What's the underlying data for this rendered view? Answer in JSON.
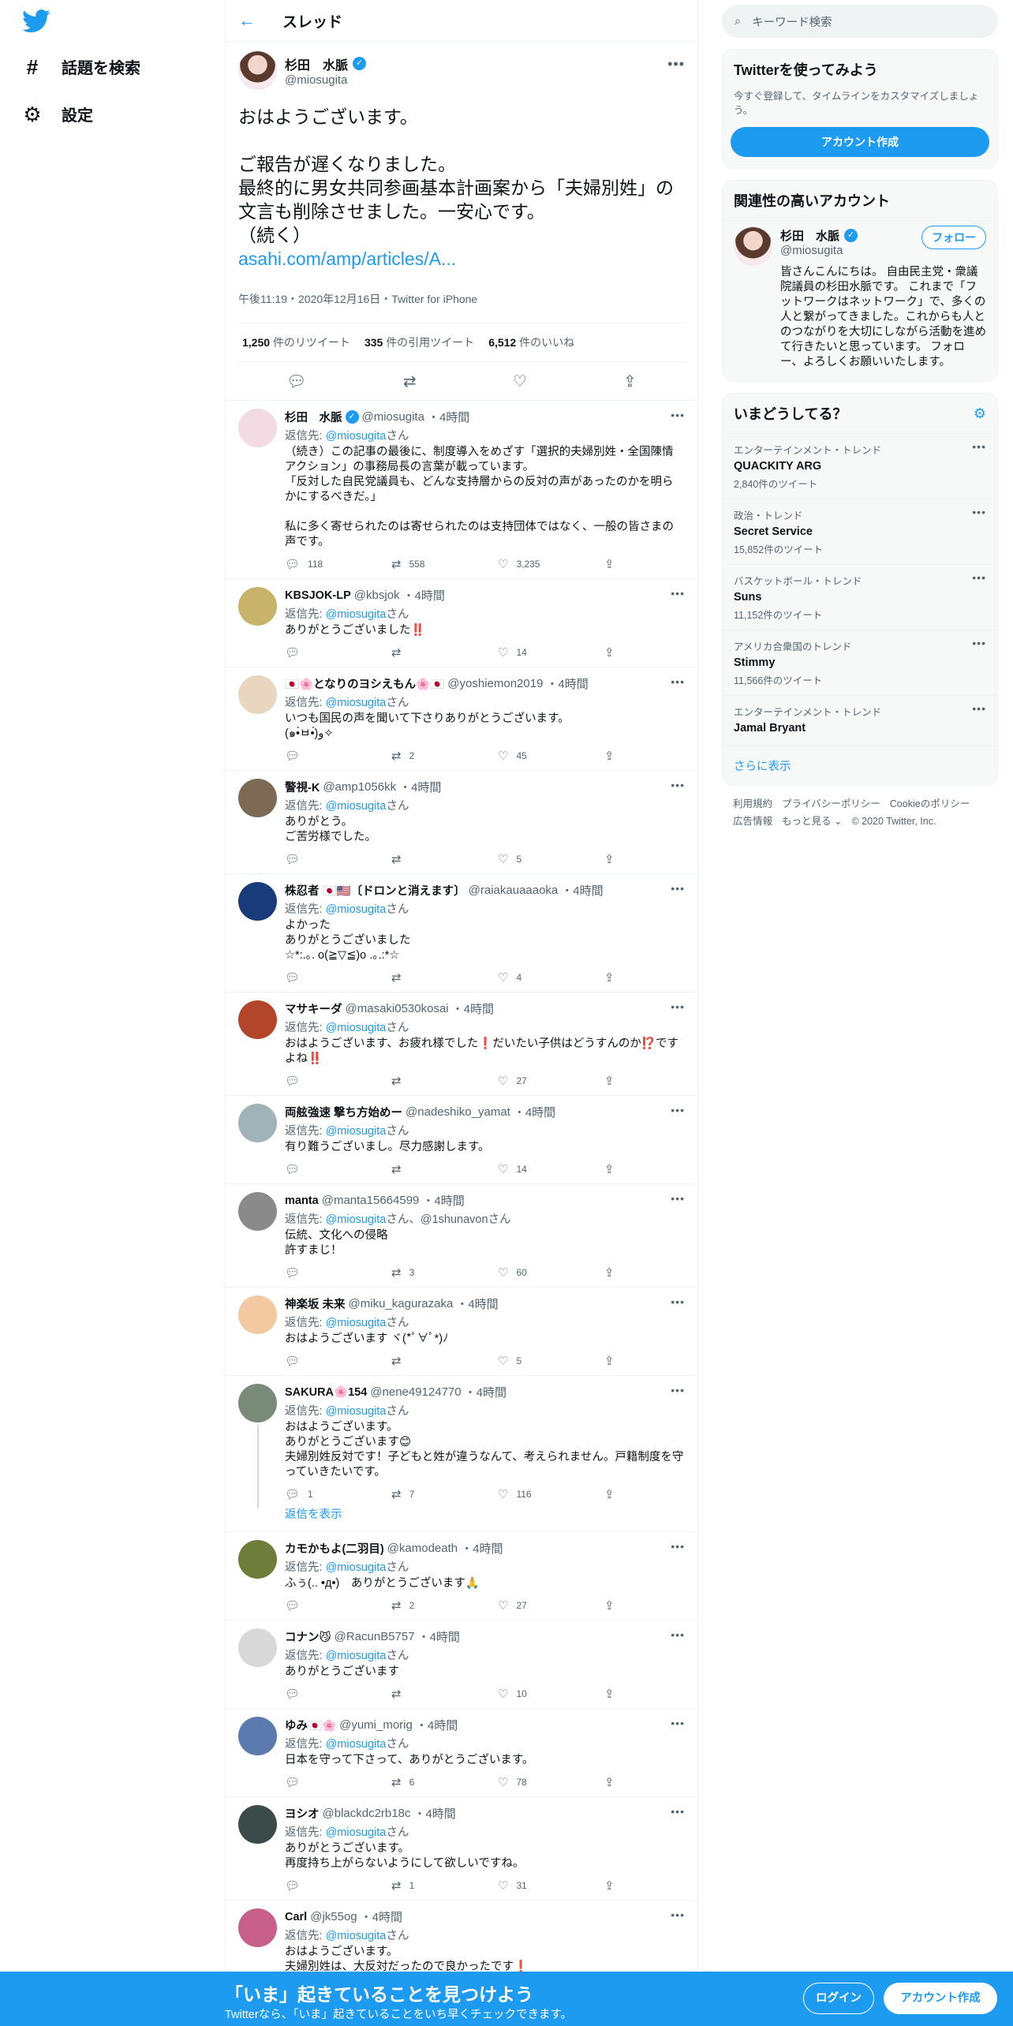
{
  "nav": {
    "explore_label": "話題を検索",
    "settings_label": "設定"
  },
  "header": {
    "title": "スレッド"
  },
  "focal_tweet": {
    "name": "杉田　水脈",
    "handle": "@miosugita",
    "text": "おはようございます。\n\nご報告が遅くなりました。\n最終的に男女共同参画基本計画案から「夫婦別姓」の文言も削除させました。一安心です。\n（続く）",
    "link": "asahi.com/amp/articles/A...",
    "meta": "午後11:19・2020年12月16日・Twitter for iPhone",
    "retweets_count": "1,250",
    "retweets_label": "件のリツイート",
    "quotes_count": "335",
    "quotes_label": "件の引用ツイート",
    "likes_count": "6,512",
    "likes_label": "件のいいね"
  },
  "replies": [
    {
      "name": "杉田　水脈",
      "handle": "@miosugita",
      "time": "・4時間",
      "to_prefix": "返信先: ",
      "to": "@miosugita",
      "to_suffix": "さん",
      "text": "（続き）この記事の最後に、制度導入をめざす「選択的夫婦別姓・全国陳情アクション」の事務局長の言葉が載っています。\n「反対した自民党議員も、どんな支持層からの反対の声があったのかを明らかにするべきだ。」\n\n私に多く寄せられたのは寄せられたのは支持団体ではなく、一般の皆さまの声です。",
      "replies": "118",
      "retweets": "558",
      "likes": "3,235"
    },
    {
      "name": "KBSJOK-LP",
      "handle": "@kbsjok",
      "time": "・4時間",
      "to_prefix": "返信先: ",
      "to": "@miosugita",
      "to_suffix": "さん",
      "text": "ありがとうございました‼️",
      "replies": "",
      "retweets": "",
      "likes": "14"
    },
    {
      "name": "🇯🇵🌸となりのヨシえもん🌸🇯🇵",
      "handle": "@yoshiemon2019",
      "time": "・4時間",
      "to_prefix": "返信先: ",
      "to": "@miosugita",
      "to_suffix": "さん",
      "text": "いつも国民の声を聞いて下さりありがとうございます。\n(๑•̀ㅂ•́)و✧",
      "replies": "",
      "retweets": "2",
      "likes": "45"
    },
    {
      "name": "警視-K",
      "handle": "@amp1056kk",
      "time": "・4時間",
      "to_prefix": "返信先: ",
      "to": "@miosugita",
      "to_suffix": "さん",
      "text": "ありがとう。\nご苦労様でした。",
      "replies": "",
      "retweets": "",
      "likes": "5"
    },
    {
      "name": "株忍者 🇯🇵🇺🇸〔ドロンと消えます〕",
      "handle": "@raiakauaaaoka",
      "time": "・4時間",
      "to_prefix": "返信先: ",
      "to": "@miosugita",
      "to_suffix": "さん",
      "text": "よかった\nありがとうございました\n☆*:.｡. o(≧▽≦)o .｡.:*☆",
      "replies": "",
      "retweets": "",
      "likes": "4"
    },
    {
      "name": "マサキーダ",
      "handle": "@masaki0530kosai",
      "time": "・4時間",
      "to_prefix": "返信先: ",
      "to": "@miosugita",
      "to_suffix": "さん",
      "text": "おはようございます、お疲れ様でした❗️だいたい子供はどうすんのか⁉️ですよね‼️",
      "replies": "",
      "retweets": "",
      "likes": "27"
    },
    {
      "name": "両舷強速 撃ち方始めー",
      "handle": "@nadeshiko_yamat",
      "time": "・4時間",
      "to_prefix": "返信先: ",
      "to": "@miosugita",
      "to_suffix": "さん",
      "text": "有り難うございまし。尽力感謝します。",
      "replies": "",
      "retweets": "",
      "likes": "14"
    },
    {
      "name": "manta",
      "handle": "@manta15664599",
      "time": "・4時間",
      "to_prefix": "返信先: ",
      "to": "@miosugita",
      "to_suffix": "さん、@1shunavonさん",
      "text": "伝統、文化への侵略\n許すまじ！",
      "replies": "",
      "retweets": "3",
      "likes": "60"
    },
    {
      "name": "神楽坂 未来",
      "handle": "@miku_kagurazaka",
      "time": "・4時間",
      "to_prefix": "返信先: ",
      "to": "@miosugita",
      "to_suffix": "さん",
      "text": "おはようございます ヾ(*ﾟ∀ﾟ*)ﾉ",
      "replies": "",
      "retweets": "",
      "likes": "5"
    },
    {
      "name": "SAKURA🌸154",
      "handle": "@nene49124770",
      "time": "・4時間",
      "to_prefix": "返信先: ",
      "to": "@miosugita",
      "to_suffix": "さん",
      "text": "おはようございます。\nありがとうございます😊\n夫婦別姓反対です！子どもと姓が違うなんて、考えられません。戸籍制度を守っていきたいです。",
      "replies": "1",
      "retweets": "7",
      "likes": "116"
    },
    {
      "name": "カモかもよ(二羽目)",
      "handle": "@kamodeath",
      "time": "・4時間",
      "to_prefix": "返信先: ",
      "to": "@miosugita",
      "to_suffix": "さん",
      "text": "ふぅ(.. •д•)　ありがとうございます🙏",
      "replies": "",
      "retweets": "2",
      "likes": "27"
    },
    {
      "name": "コナン😼",
      "handle": "@RacunB5757",
      "time": "・4時間",
      "to_prefix": "返信先: ",
      "to": "@miosugita",
      "to_suffix": "さん",
      "text": "ありがとうございます",
      "replies": "",
      "retweets": "",
      "likes": "10"
    },
    {
      "name": "ゆみ🇯🇵🌸",
      "handle": "@yumi_morig",
      "time": "・4時間",
      "to_prefix": "返信先: ",
      "to": "@miosugita",
      "to_suffix": "さん",
      "text": "日本を守って下さって、ありがとうございます。",
      "replies": "",
      "retweets": "6",
      "likes": "78"
    },
    {
      "name": "ヨシオ",
      "handle": "@blackdc2rb18c",
      "time": "・4時間",
      "to_prefix": "返信先: ",
      "to": "@miosugita",
      "to_suffix": "さん",
      "text": "ありがとうございます。\n再度持ち上がらないようにして欲しいですね。",
      "replies": "",
      "retweets": "1",
      "likes": "31"
    },
    {
      "name": "Carl",
      "handle": "@jk55og",
      "time": "・4時間",
      "to_prefix": "返信先: ",
      "to": "@miosugita",
      "to_suffix": "さん",
      "text": "おはようございます。\n夫婦別姓は、大反対だったので良かったです❗️",
      "replies": "",
      "retweets": "",
      "likes": ""
    }
  ],
  "show_replies_label": "返信を表示",
  "right": {
    "search_placeholder": "キーワード検索",
    "signup_title": "Twitterを使ってみよう",
    "signup_sub": "今すぐ登録して、タイムラインをカスタマイズしましょう。",
    "signup_button": "アカウント作成",
    "wtf_title": "関連性の高いアカウント",
    "wtf_name": "杉田　水脈",
    "wtf_handle": "@miosugita",
    "wtf_follow": "フォロー",
    "wtf_bio": "皆さんこんにちは。 自由民主党・衆議院議員の杉田水脈です。 これまで「フットワークはネットワーク」で、多くの人と繋がってきました。これからも人とのつながりを大切にしながら活動を進めて行きたいと思っています。 フォロー、よろしくお願いいたします。",
    "trends_title": "いまどうしてる？",
    "trends": [
      {
        "cat": "エンターテインメント・トレンド",
        "name": "QUACKITY ARG",
        "count": "2,840件のツイート"
      },
      {
        "cat": "政治・トレンド",
        "name": "Secret Service",
        "count": "15,852件のツイート"
      },
      {
        "cat": "バスケットボール・トレンド",
        "name": "Suns",
        "count": "11,152件のツイート"
      },
      {
        "cat": "アメリカ合衆国のトレンド",
        "name": "Stimmy",
        "count": "11,566件のツイート"
      },
      {
        "cat": "エンターテインメント・トレンド",
        "name": "Jamal Bryant",
        "count": ""
      }
    ],
    "show_more": "さらに表示",
    "footer": [
      "利用規約",
      "プライバシーポリシー",
      "Cookieのポリシー",
      "広告情報",
      "もっと見る ⌄",
      "© 2020 Twitter, Inc."
    ]
  },
  "bottom_bar": {
    "title": "「いま」起きていることを見つけよう",
    "sub": "Twitterなら、「いま」起きていることをいち早くチェックできます。",
    "login": "ログイン",
    "signup": "アカウント作成"
  },
  "colors": {
    "accent": "#1d9bf0",
    "text": "#0f1419",
    "muted": "#536471",
    "border": "#eff3f4"
  }
}
